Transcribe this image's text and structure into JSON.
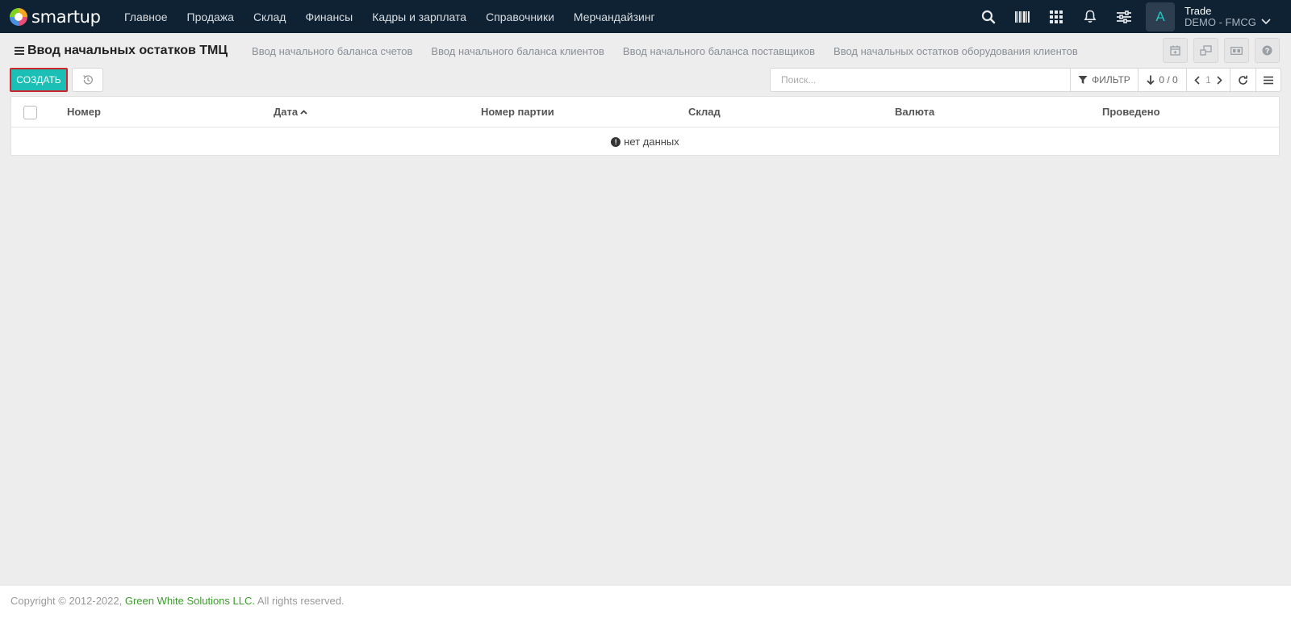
{
  "app": {
    "logo_text": "smartup"
  },
  "nav": {
    "items": [
      {
        "label": "Главное"
      },
      {
        "label": "Продажа"
      },
      {
        "label": "Склад"
      },
      {
        "label": "Финансы"
      },
      {
        "label": "Кадры и зарплата"
      },
      {
        "label": "Справочники"
      },
      {
        "label": "Мерчандайзинг"
      }
    ]
  },
  "top_icons": [
    "search-icon",
    "barcode-icon",
    "apps-grid-icon",
    "bell-icon",
    "settings-sliders-icon"
  ],
  "user": {
    "avatar_letter": "A",
    "name": "Trade",
    "company": "DEMO - FMCG"
  },
  "page": {
    "title": "Ввод начальных остатков ТМЦ",
    "related_links": [
      {
        "label": "Ввод начального баланса счетов"
      },
      {
        "label": "Ввод начального баланса клиентов"
      },
      {
        "label": "Ввод начального баланса поставщиков"
      },
      {
        "label": "Ввод начальных остатков оборудования клиентов"
      }
    ],
    "header_buttons": [
      "calendar-icon",
      "transfer-icon",
      "card-icon",
      "help-icon"
    ]
  },
  "toolbar": {
    "create_label": "СОЗДАТЬ",
    "search_placeholder": "Поиск...",
    "filter_label": "ФИЛЬТР",
    "count_label": "0 / 0",
    "page_number": "1"
  },
  "table": {
    "columns": [
      {
        "label": "Номер"
      },
      {
        "label": "Дата"
      },
      {
        "label": "Номер партии"
      },
      {
        "label": "Склад"
      },
      {
        "label": "Валюта"
      },
      {
        "label": "Проведено"
      }
    ],
    "sorted_column": "Дата",
    "sort_direction": "ascending",
    "empty_text": "нет данных"
  },
  "footer": {
    "copyright": "Copyright © 2012-2022,",
    "company_link": "Green White Solutions LLC.",
    "rights": "All rights reserved."
  },
  "colors": {
    "nav_bg": "#0f2233",
    "accent": "#1bbfb5",
    "link_green": "#3a9d2a",
    "create_outline": "#d0252d"
  }
}
